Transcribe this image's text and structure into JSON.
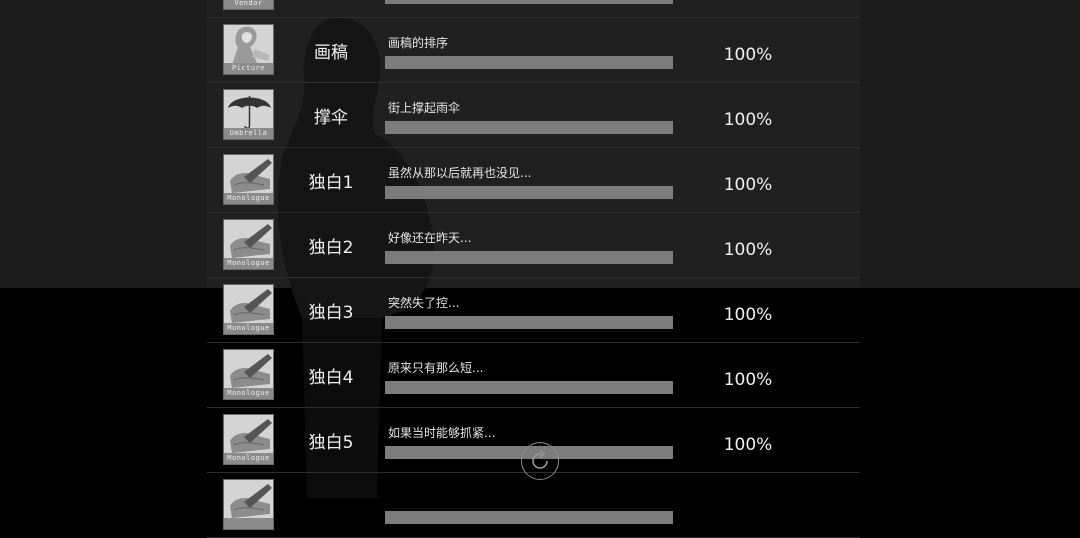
{
  "rows": [
    {
      "tag": "Vendor",
      "icon": "vendor-icon",
      "title": "",
      "desc": "",
      "progress": 1.0,
      "pct": ""
    },
    {
      "tag": "Picture",
      "icon": "picture-icon",
      "title": "画稿",
      "desc": "画稿的排序",
      "progress": 1.0,
      "pct": "100%"
    },
    {
      "tag": "Umbrella",
      "icon": "umbrella-icon",
      "title": "撑伞",
      "desc": "街上撑起雨伞",
      "progress": 1.0,
      "pct": "100%"
    },
    {
      "tag": "Monologue",
      "icon": "monologue-icon",
      "title": "独白1",
      "desc": "虽然从那以后就再也没见...",
      "progress": 1.0,
      "pct": "100%"
    },
    {
      "tag": "Monologue",
      "icon": "monologue-icon",
      "title": "独白2",
      "desc": "好像还在昨天...",
      "progress": 1.0,
      "pct": "100%"
    },
    {
      "tag": "Monologue",
      "icon": "monologue-icon",
      "title": "独白3",
      "desc": "突然失了控...",
      "progress": 1.0,
      "pct": "100%"
    },
    {
      "tag": "Monologue",
      "icon": "monologue-icon",
      "title": "独白4",
      "desc": "原来只有那么短...",
      "progress": 1.0,
      "pct": "100%"
    },
    {
      "tag": "Monologue",
      "icon": "monologue-icon",
      "title": "独白5",
      "desc": "如果当时能够抓紧...",
      "progress": 1.0,
      "pct": "100%"
    },
    {
      "tag": "",
      "icon": "monologue-icon",
      "title": "",
      "desc": "",
      "progress": 1.0,
      "pct": ""
    }
  ],
  "refresh_icon": "refresh-icon"
}
